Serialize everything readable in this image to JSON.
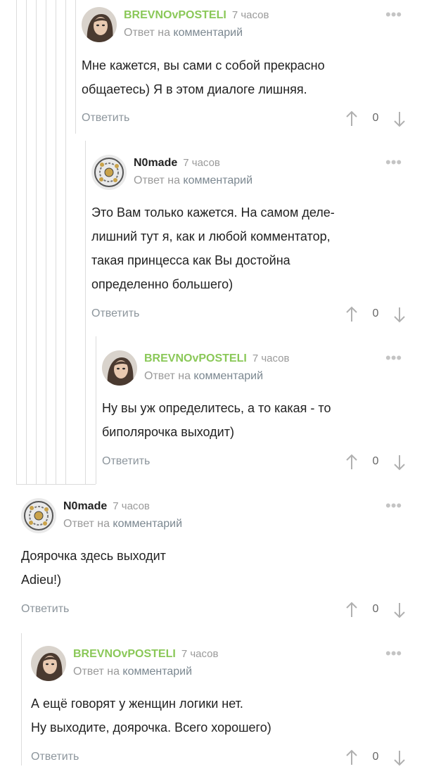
{
  "colors": {
    "author_green": "#8ac858",
    "muted": "#9a9a9a",
    "line": "#dcdcdc"
  },
  "comments": [
    {
      "author": "BREVNOvPOSTELI",
      "time": "7 часов",
      "reply_prefix": "Ответ на",
      "reply_link": "комментарий",
      "text": "Мне кажется, вы сами с собой прекрасно\nобщаетесь) Я в этом диалоге лишняя.",
      "reply_label": "Ответить",
      "score": "0",
      "avatar_icon": "female-avatar-icon"
    },
    {
      "author": "N0made",
      "time": "7 часов",
      "reply_prefix": "Ответ на",
      "reply_link": "комментарий",
      "text": "Это Вам только кажется. На самом деле-\nлишний тут я, как и любой комментатор,\nтакая принцесса как Вы достойна\nопределенно большего)",
      "reply_label": "Ответить",
      "score": "0",
      "avatar_icon": "ornament-avatar-icon"
    },
    {
      "author": "BREVNOvPOSTELI",
      "time": "7 часов",
      "reply_prefix": "Ответ на",
      "reply_link": "комментарий",
      "text": "Ну вы уж определитесь, а то какая - то\nбиполярочка выходит)",
      "reply_label": "Ответить",
      "score": "0",
      "avatar_icon": "female-avatar-icon"
    },
    {
      "author": "N0made",
      "time": "7 часов",
      "reply_prefix": "Ответ на",
      "reply_link": "комментарий",
      "text": "Доярочка здесь выходит\nAdieu!)",
      "reply_label": "Ответить",
      "score": "0",
      "avatar_icon": "ornament-avatar-icon"
    },
    {
      "author": "BREVNOvPOSTELI",
      "time": "7 часов",
      "reply_prefix": "Ответ на",
      "reply_link": "комментарий",
      "text": "А ещё говорят у женщин логики нет.\nНу выходите, доярочка. Всего хорошего)",
      "reply_label": "Ответить",
      "score": "0",
      "avatar_icon": "female-avatar-icon"
    }
  ]
}
